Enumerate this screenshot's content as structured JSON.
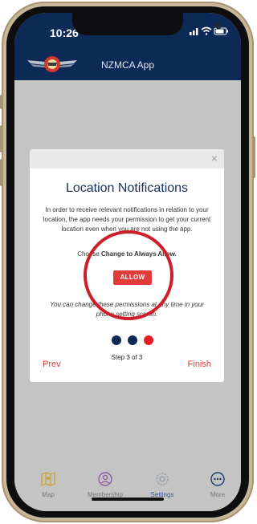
{
  "status_bar": {
    "time": "10:26"
  },
  "header": {
    "title": "NZMCA App",
    "logo_icon": "nzmca-logo-icon"
  },
  "modal": {
    "close_symbol": "×",
    "title": "Location Notifications",
    "body": "In order to receive relevant notifications in relation to your location, the app needs your permission to get your current location even when you are not using the app.",
    "choose_prefix": "Choose ",
    "choose_bold": "Change to Always Allow.",
    "allow_label": "ALLOW",
    "note": "You can change these permissions at any time in your phone setting screen.",
    "step_label": "Step 3 of 3",
    "prev_label": "Prev",
    "finish_label": "Finish",
    "dots": [
      {
        "state": "completed",
        "color": "#0d2a57"
      },
      {
        "state": "completed",
        "color": "#0d2a57"
      },
      {
        "state": "current",
        "color": "#e81c24"
      }
    ]
  },
  "tabbar": {
    "items": [
      {
        "label": "Map",
        "icon": "map-icon",
        "active": false
      },
      {
        "label": "Membership",
        "icon": "person-icon",
        "active": false
      },
      {
        "label": "Settings",
        "icon": "gear-icon",
        "active": true
      },
      {
        "label": "More",
        "icon": "more-icon",
        "active": false
      }
    ]
  },
  "colors": {
    "header_bg": "#0d2a57",
    "accent_red": "#e23b3b",
    "highlight_ring": "#cc1f2a",
    "overlay_grey": "#c4c4c4"
  }
}
